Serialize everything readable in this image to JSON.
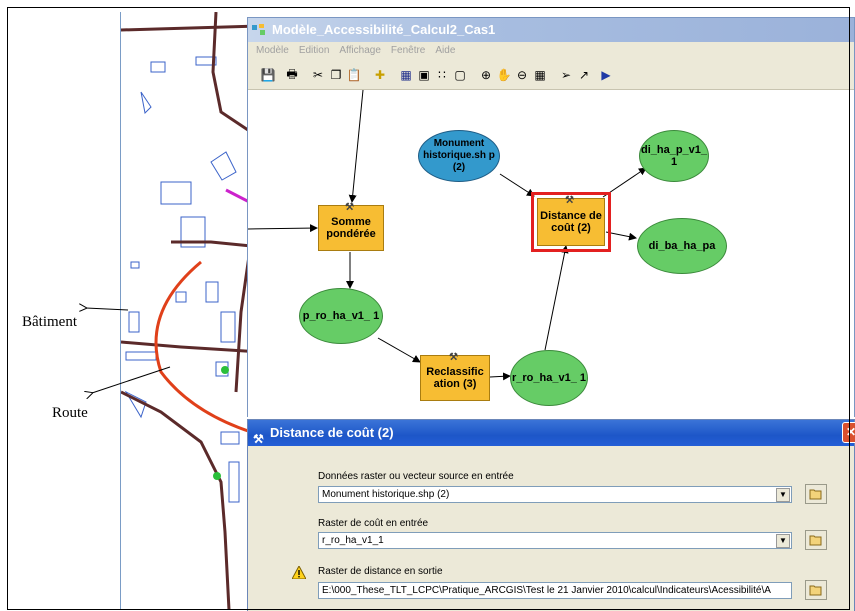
{
  "annotations": {
    "batiment": "Bâtiment",
    "route": "Route"
  },
  "model_window": {
    "title": "Modèle_Accessibilité_Calcul2_Cas1",
    "menu": [
      "Modèle",
      "Edition",
      "Affichage",
      "Fenêtre",
      "Aide"
    ],
    "nodes": {
      "monument": "Monument historique.sh p (2)",
      "somme": "Somme pondérée",
      "distance": "Distance de coût (2)",
      "di_ha": "di_ha_p_v1_ 1",
      "di_ba": "di_ba_ha_pa",
      "p_ro": "p_ro_ha_v1_ 1",
      "reclass": "Reclassific ation (3)",
      "r_ro": "r_ro_ha_v1_ 1"
    }
  },
  "dialog": {
    "title": "Distance de coût (2)",
    "fields": [
      {
        "label": "Données raster ou vecteur source en entrée",
        "value": "Monument historique.shp (2)"
      },
      {
        "label": "Raster de coût en entrée",
        "value": "r_ro_ha_v1_1"
      },
      {
        "label": "Raster de distance en sortie",
        "value": "E:\\000_These_TLT_LCPC\\Pratique_ARCGIS\\Test le 21 Janvier 2010\\calcul\\Indicateurs\\Acessibilité\\A"
      }
    ]
  },
  "colors": {
    "green_node": "#66cc66",
    "blue_node": "#3399cc",
    "tool_node": "#f7bd33",
    "selection": "#e32020",
    "road_red": "#e0401a"
  }
}
